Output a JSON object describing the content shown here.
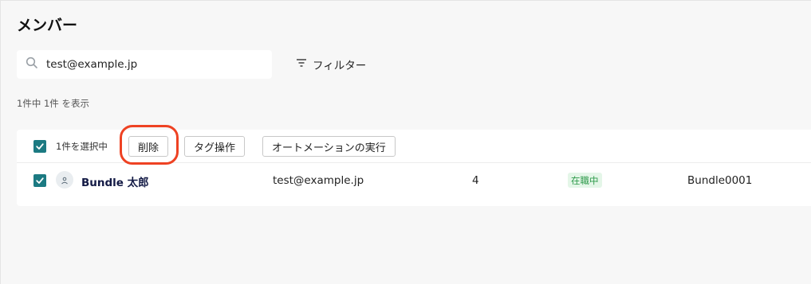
{
  "page": {
    "title": "メンバー"
  },
  "search": {
    "value": "test@example.jp"
  },
  "filter": {
    "label": "フィルター"
  },
  "results": {
    "count_text": "1件中 1件 を表示"
  },
  "bulk_actions": {
    "selected_text": "1件を選択中",
    "delete_label": "削除",
    "tag_label": "タグ操作",
    "automation_label": "オートメーションの実行"
  },
  "members": [
    {
      "name": "Bundle 太郎",
      "email": "test@example.jp",
      "count": "4",
      "status": "在職中",
      "code": "Bundle0001",
      "checked": true
    }
  ],
  "colors": {
    "checkbox": "#1c7a82",
    "highlight": "#ee4223",
    "status_bg": "#e4f6e8",
    "status_text": "#2f9b4c",
    "name_text": "#131a45"
  },
  "icons": {
    "search": "search-icon",
    "filter": "filter-icon",
    "check": "checkmark-icon",
    "avatar": "user-icon"
  }
}
